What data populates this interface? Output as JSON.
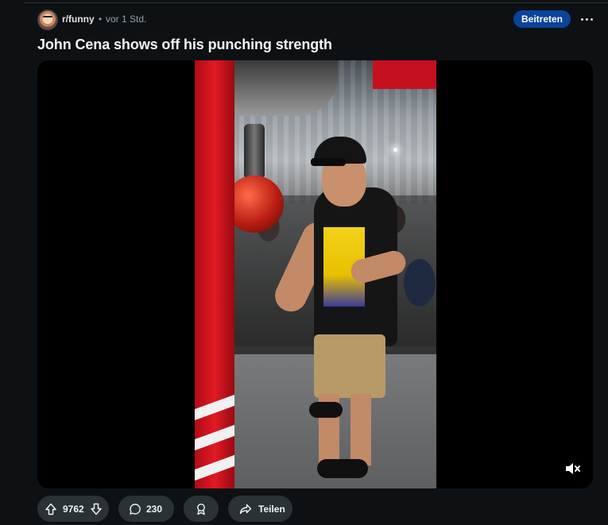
{
  "post": {
    "subreddit": "r/funny",
    "separator": "•",
    "time_ago": "vor 1 Std.",
    "join_label": "Beitreten",
    "title": "John Cena shows off his punching strength"
  },
  "actions": {
    "upvotes": "9762",
    "comments": "230",
    "share_label": "Teilen"
  },
  "icons": {
    "more": "more-options-icon",
    "upvote": "upvote-arrow-icon",
    "downvote": "downvote-arrow-icon",
    "comment": "comment-bubble-icon",
    "award": "award-icon",
    "share": "share-arrow-icon",
    "mute": "muted-speaker-icon"
  },
  "colors": {
    "background": "#0e1113",
    "join_button": "#0a449b",
    "pill": "#2a3236"
  }
}
